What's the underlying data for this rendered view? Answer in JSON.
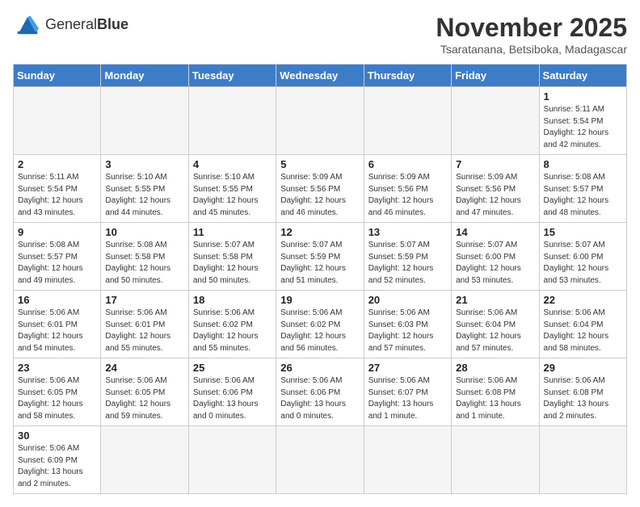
{
  "header": {
    "logo_text_normal": "General",
    "logo_text_bold": "Blue",
    "month_title": "November 2025",
    "location": "Tsaratanana, Betsiboka, Madagascar"
  },
  "days_of_week": [
    "Sunday",
    "Monday",
    "Tuesday",
    "Wednesday",
    "Thursday",
    "Friday",
    "Saturday"
  ],
  "weeks": [
    {
      "days": [
        {
          "num": "",
          "info": ""
        },
        {
          "num": "",
          "info": ""
        },
        {
          "num": "",
          "info": ""
        },
        {
          "num": "",
          "info": ""
        },
        {
          "num": "",
          "info": ""
        },
        {
          "num": "",
          "info": ""
        },
        {
          "num": "1",
          "info": "Sunrise: 5:11 AM\nSunset: 5:54 PM\nDaylight: 12 hours\nand 42 minutes."
        }
      ]
    },
    {
      "days": [
        {
          "num": "2",
          "info": "Sunrise: 5:11 AM\nSunset: 5:54 PM\nDaylight: 12 hours\nand 43 minutes."
        },
        {
          "num": "3",
          "info": "Sunrise: 5:10 AM\nSunset: 5:55 PM\nDaylight: 12 hours\nand 44 minutes."
        },
        {
          "num": "4",
          "info": "Sunrise: 5:10 AM\nSunset: 5:55 PM\nDaylight: 12 hours\nand 45 minutes."
        },
        {
          "num": "5",
          "info": "Sunrise: 5:09 AM\nSunset: 5:56 PM\nDaylight: 12 hours\nand 46 minutes."
        },
        {
          "num": "6",
          "info": "Sunrise: 5:09 AM\nSunset: 5:56 PM\nDaylight: 12 hours\nand 46 minutes."
        },
        {
          "num": "7",
          "info": "Sunrise: 5:09 AM\nSunset: 5:56 PM\nDaylight: 12 hours\nand 47 minutes."
        },
        {
          "num": "8",
          "info": "Sunrise: 5:08 AM\nSunset: 5:57 PM\nDaylight: 12 hours\nand 48 minutes."
        }
      ]
    },
    {
      "days": [
        {
          "num": "9",
          "info": "Sunrise: 5:08 AM\nSunset: 5:57 PM\nDaylight: 12 hours\nand 49 minutes."
        },
        {
          "num": "10",
          "info": "Sunrise: 5:08 AM\nSunset: 5:58 PM\nDaylight: 12 hours\nand 50 minutes."
        },
        {
          "num": "11",
          "info": "Sunrise: 5:07 AM\nSunset: 5:58 PM\nDaylight: 12 hours\nand 50 minutes."
        },
        {
          "num": "12",
          "info": "Sunrise: 5:07 AM\nSunset: 5:59 PM\nDaylight: 12 hours\nand 51 minutes."
        },
        {
          "num": "13",
          "info": "Sunrise: 5:07 AM\nSunset: 5:59 PM\nDaylight: 12 hours\nand 52 minutes."
        },
        {
          "num": "14",
          "info": "Sunrise: 5:07 AM\nSunset: 6:00 PM\nDaylight: 12 hours\nand 53 minutes."
        },
        {
          "num": "15",
          "info": "Sunrise: 5:07 AM\nSunset: 6:00 PM\nDaylight: 12 hours\nand 53 minutes."
        }
      ]
    },
    {
      "days": [
        {
          "num": "16",
          "info": "Sunrise: 5:06 AM\nSunset: 6:01 PM\nDaylight: 12 hours\nand 54 minutes."
        },
        {
          "num": "17",
          "info": "Sunrise: 5:06 AM\nSunset: 6:01 PM\nDaylight: 12 hours\nand 55 minutes."
        },
        {
          "num": "18",
          "info": "Sunrise: 5:06 AM\nSunset: 6:02 PM\nDaylight: 12 hours\nand 55 minutes."
        },
        {
          "num": "19",
          "info": "Sunrise: 5:06 AM\nSunset: 6:02 PM\nDaylight: 12 hours\nand 56 minutes."
        },
        {
          "num": "20",
          "info": "Sunrise: 5:06 AM\nSunset: 6:03 PM\nDaylight: 12 hours\nand 57 minutes."
        },
        {
          "num": "21",
          "info": "Sunrise: 5:06 AM\nSunset: 6:04 PM\nDaylight: 12 hours\nand 57 minutes."
        },
        {
          "num": "22",
          "info": "Sunrise: 5:06 AM\nSunset: 6:04 PM\nDaylight: 12 hours\nand 58 minutes."
        }
      ]
    },
    {
      "days": [
        {
          "num": "23",
          "info": "Sunrise: 5:06 AM\nSunset: 6:05 PM\nDaylight: 12 hours\nand 58 minutes."
        },
        {
          "num": "24",
          "info": "Sunrise: 5:06 AM\nSunset: 6:05 PM\nDaylight: 12 hours\nand 59 minutes."
        },
        {
          "num": "25",
          "info": "Sunrise: 5:06 AM\nSunset: 6:06 PM\nDaylight: 13 hours\nand 0 minutes."
        },
        {
          "num": "26",
          "info": "Sunrise: 5:06 AM\nSunset: 6:06 PM\nDaylight: 13 hours\nand 0 minutes."
        },
        {
          "num": "27",
          "info": "Sunrise: 5:06 AM\nSunset: 6:07 PM\nDaylight: 13 hours\nand 1 minute."
        },
        {
          "num": "28",
          "info": "Sunrise: 5:06 AM\nSunset: 6:08 PM\nDaylight: 13 hours\nand 1 minute."
        },
        {
          "num": "29",
          "info": "Sunrise: 5:06 AM\nSunset: 6:08 PM\nDaylight: 13 hours\nand 2 minutes."
        }
      ]
    },
    {
      "days": [
        {
          "num": "30",
          "info": "Sunrise: 5:06 AM\nSunset: 6:09 PM\nDaylight: 13 hours\nand 2 minutes."
        },
        {
          "num": "",
          "info": ""
        },
        {
          "num": "",
          "info": ""
        },
        {
          "num": "",
          "info": ""
        },
        {
          "num": "",
          "info": ""
        },
        {
          "num": "",
          "info": ""
        },
        {
          "num": "",
          "info": ""
        }
      ]
    }
  ]
}
